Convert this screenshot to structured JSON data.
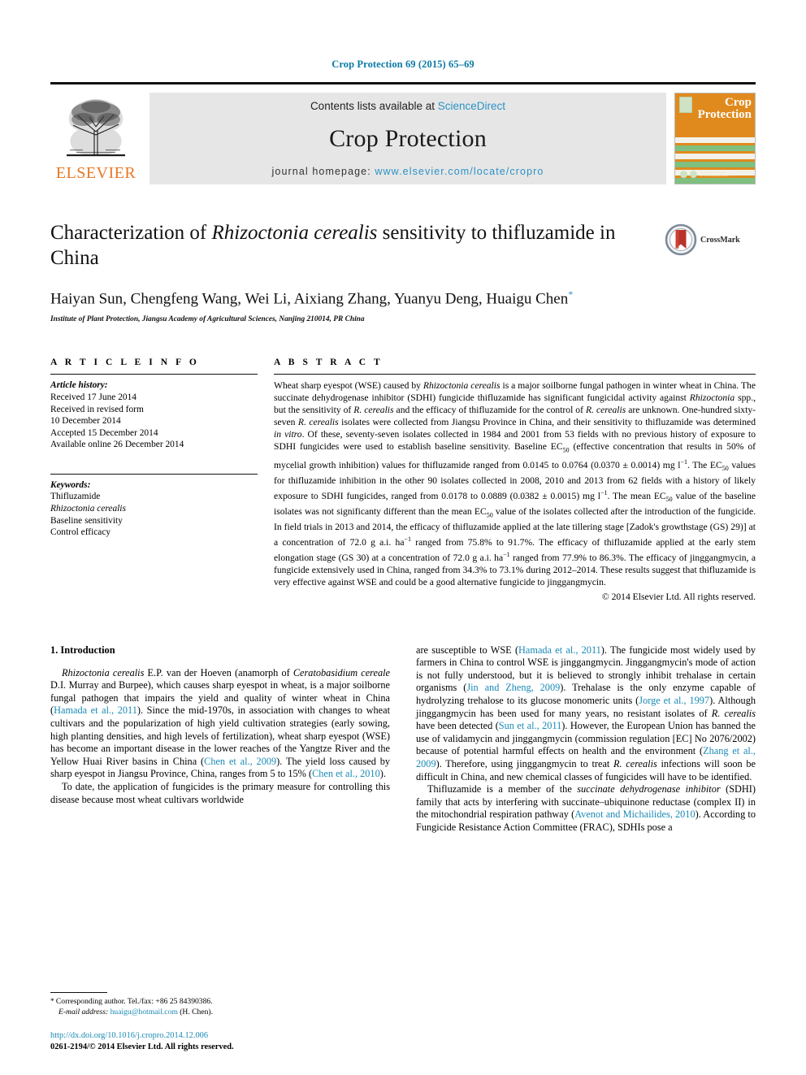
{
  "running_head": "Crop Protection 69 (2015) 65–69",
  "masthead": {
    "publisher_logo_text": "ELSEVIER",
    "contents_prefix": "Contents lists available at ",
    "contents_link": "ScienceDirect",
    "journal_name": "Crop Protection",
    "homepage_prefix": "journal homepage: ",
    "homepage_url": "www.elsevier.com/locate/cropro",
    "cover": {
      "line1": "Crop",
      "line2": "Protection"
    }
  },
  "article": {
    "title_part1": "Characterization of ",
    "title_italic": "Rhizoctonia cerealis",
    "title_part2": " sensitivity to thifluzamide",
    "title_line2": "in China",
    "authors": "Haiyan Sun, Chengfeng Wang, Wei Li, Aixiang Zhang, Yuanyu Deng, Huaigu Chen",
    "author_marker": "*",
    "affiliation": "Institute of Plant Protection, Jiangsu Academy of Agricultural Sciences, Nanjing 210014, PR China",
    "crossmark_label": "CrossMark"
  },
  "article_info": {
    "heading": "A R T I C L E   I N F O",
    "history_label": "Article history:",
    "history": [
      "Received 17 June 2014",
      "Received in revised form",
      "10 December 2014",
      "Accepted 15 December 2014",
      "Available online 26 December 2014"
    ],
    "keywords_label": "Keywords:",
    "keywords": [
      "Thifluzamide",
      "Rhizoctonia cerealis",
      "Baseline sensitivity",
      "Control efficacy"
    ],
    "keyword_italic_index": 1
  },
  "abstract": {
    "heading": "A B S T R A C T",
    "paragraphs": [
      "Wheat sharp eyespot (WSE) caused by Rhizoctonia cerealis is a major soilborne fungal pathogen in winter wheat in China. The succinate dehydrogenase inhibitor (SDHI) fungicide thifluzamide has significant fungicidal activity against Rhizoctonia spp., but the sensitivity of R. cerealis and the efficacy of thifluzamide for the control of R. cerealis are unknown. One-hundred sixty-seven R. cerealis isolates were collected from Jiangsu Province in China, and their sensitivity to thifluzamide was determined in vitro. Of these, seventy-seven isolates collected in 1984 and 2001 from 53 fields with no previous history of exposure to SDHI fungicides were used to establish baseline sensitivity. Baseline EC50 (effective concentration that results in 50% of mycelial growth inhibition) values for thifluzamide ranged from 0.0145 to 0.0764 (0.0370 ± 0.0014) mg l−1. The EC50 values for thifluzamide inhibition in the other 90 isolates collected in 2008, 2010 and 2013 from 62 fields with a history of likely exposure to SDHI fungicides, ranged from 0.0178 to 0.0889 (0.0382 ± 0.0015) mg l−1. The mean EC50 value of the baseline isolates was not significanty different than the mean EC50 value of the isolates collected after the introduction of the fungicide. In field trials in 2013 and 2014, the efficacy of thifluzamide applied at the late tillering stage [Zadok's growthstage (GS) 29)] at a concentration of 72.0 g a.i. ha−1 ranged from 75.8% to 91.7%. The efficacy of thifluzamide applied at the early stem elongation stage (GS 30) at a concentration of 72.0 g a.i. ha−1 ranged from 77.9% to 86.3%. The efficacy of jinggangmycin, a fungicide extensively used in China, ranged from 34.3% to 73.1% during 2012–2014. These results suggest that thifluzamide is very effective against WSE and could be a good alternative fungicide to jinggangmycin."
    ],
    "copyright": "© 2014 Elsevier Ltd. All rights reserved."
  },
  "sections": {
    "intro_heading": "1. Introduction",
    "left_paragraphs": [
      "Rhizoctonia cerealis E.P. van der Hoeven (anamorph of Ceratobasidium cereale D.I. Murray and Burpee), which causes sharp eyespot in wheat, is a major soilborne fungal pathogen that impairs the yield and quality of winter wheat in China (Hamada et al., 2011). Since the mid-1970s, in association with changes to wheat cultivars and the popularization of high yield cultivation strategies (early sowing, high planting densities, and high levels of fertilization), wheat sharp eyespot (WSE) has become an important disease in the lower reaches of the Yangtze River and the Yellow Huai River basins in China (Chen et al., 2009). The yield loss caused by sharp eyespot in Jiangsu Province, China, ranges from 5 to 15% (Chen et al., 2010).",
      "To date, the application of fungicides is the primary measure for controlling this disease because most wheat cultivars worldwide"
    ],
    "right_paragraphs": [
      "are susceptible to WSE (Hamada et al., 2011). The fungicide most widely used by farmers in China to control WSE is jinggangmycin. Jinggangmycin's mode of action is not fully understood, but it is believed to strongly inhibit trehalase in certain organisms (Jin and Zheng, 2009). Trehalase is the only enzyme capable of hydrolyzing trehalose to its glucose monomeric units (Jorge et al., 1997). Although jinggangmycin has been used for many years, no resistant isolates of R. cerealis have been detected (Sun et al., 2011). However, the European Union has banned the use of validamycin and jinggangmycin (commission regulation [EC] No 2076/2002) because of potential harmful effects on health and the environment (Zhang et al., 2009). Therefore, using jinggangmycin to treat R. cerealis infections will soon be difficult in China, and new chemical classes of fungicides will have to be identified.",
      "Thifluzamide is a member of the succinate dehydrogenase inhibitor (SDHI) family that acts by interfering with succinate—ubiquinone reductase (complex II) in the mitochondrial respiration pathway (Avenot and Michailides, 2010). According to Fungicide Resistance Action Committee (FRAC), SDHIs pose a"
    ]
  },
  "footer": {
    "corresponding_marker": "*",
    "corresponding_text": "Corresponding author. Tel./fax: +86 25 84390386.",
    "email_label": "E-mail address:",
    "email": "huaigu@hotmail.com",
    "email_suffix": "(H. Chen).",
    "doi": "http://dx.doi.org/10.1016/j.cropro.2014.12.006",
    "issn_line": "0261-2194/© 2014 Elsevier Ltd. All rights reserved."
  },
  "colors": {
    "link": "#1a8ab5",
    "running_head": "#0b7aa5",
    "elsevier_orange": "#e87722",
    "cover_orange": "#e08a1e",
    "band_gray": "#e6e6e6"
  }
}
